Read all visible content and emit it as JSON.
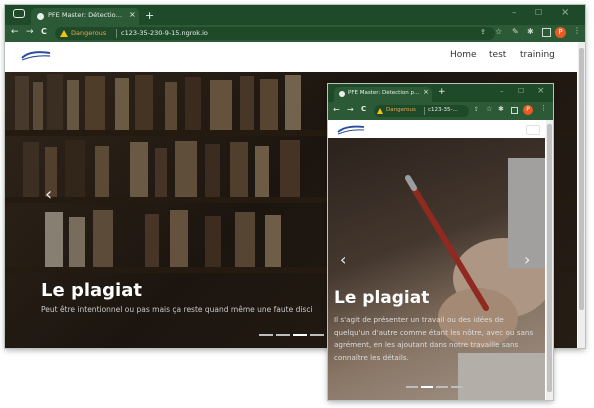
{
  "colors": {
    "frame": "#1f4a2a",
    "toolbar": "#2c5a37",
    "accent": "#e85b22",
    "warning": "#f1a34a"
  },
  "main_window": {
    "tab_title": "PFE Master: Détection plagiat en",
    "tab_close": "×",
    "new_tab": "+",
    "controls": {
      "minimize": "–",
      "maximize": "☐",
      "close": "×"
    },
    "nav": {
      "back": "←",
      "forward": "→",
      "reload": "C"
    },
    "security_label": "Dangerous",
    "url": "c123-35-230-9-15.ngrok.io",
    "toolbar_icons": [
      "share-icon",
      "star-icon",
      "pen-icon",
      "puzzle-icon",
      "sidebar-icon"
    ],
    "avatar_letter": "P",
    "site": {
      "nav_links": [
        "Home",
        "test",
        "training"
      ],
      "carousel": {
        "caption_title": "Le plagiat",
        "caption_text": "Peut être intentionnel ou pas mais ça reste quand même une faute disci",
        "prev": "‹",
        "next": "›",
        "indicators": 4,
        "active_indicator": 3
      }
    }
  },
  "second_window": {
    "tab_title": "PFE Master: Détection plagiat",
    "tab_close": "×",
    "new_tab": "+",
    "controls": {
      "minimize": "–",
      "maximize": "☐",
      "close": "×"
    },
    "nav": {
      "back": "←",
      "forward": "→",
      "reload": "C"
    },
    "security_label": "Dangerous",
    "url": "c123-35-...",
    "toolbar_icons": [
      "share-icon",
      "star-icon",
      "puzzle-icon",
      "sidebar-icon"
    ],
    "avatar_letter": "P",
    "site": {
      "carousel": {
        "caption_title": "Le plagiat",
        "caption_text": "Il s'agit de présenter un travail ou des idées de quelqu'un d'autre comme étant les nôtre, avec ou sans agrément, en les ajoutant dans notre travaille sans connaître les détails.",
        "prev": "‹",
        "next": "›",
        "indicators": 4,
        "active_indicator": 1
      }
    }
  }
}
